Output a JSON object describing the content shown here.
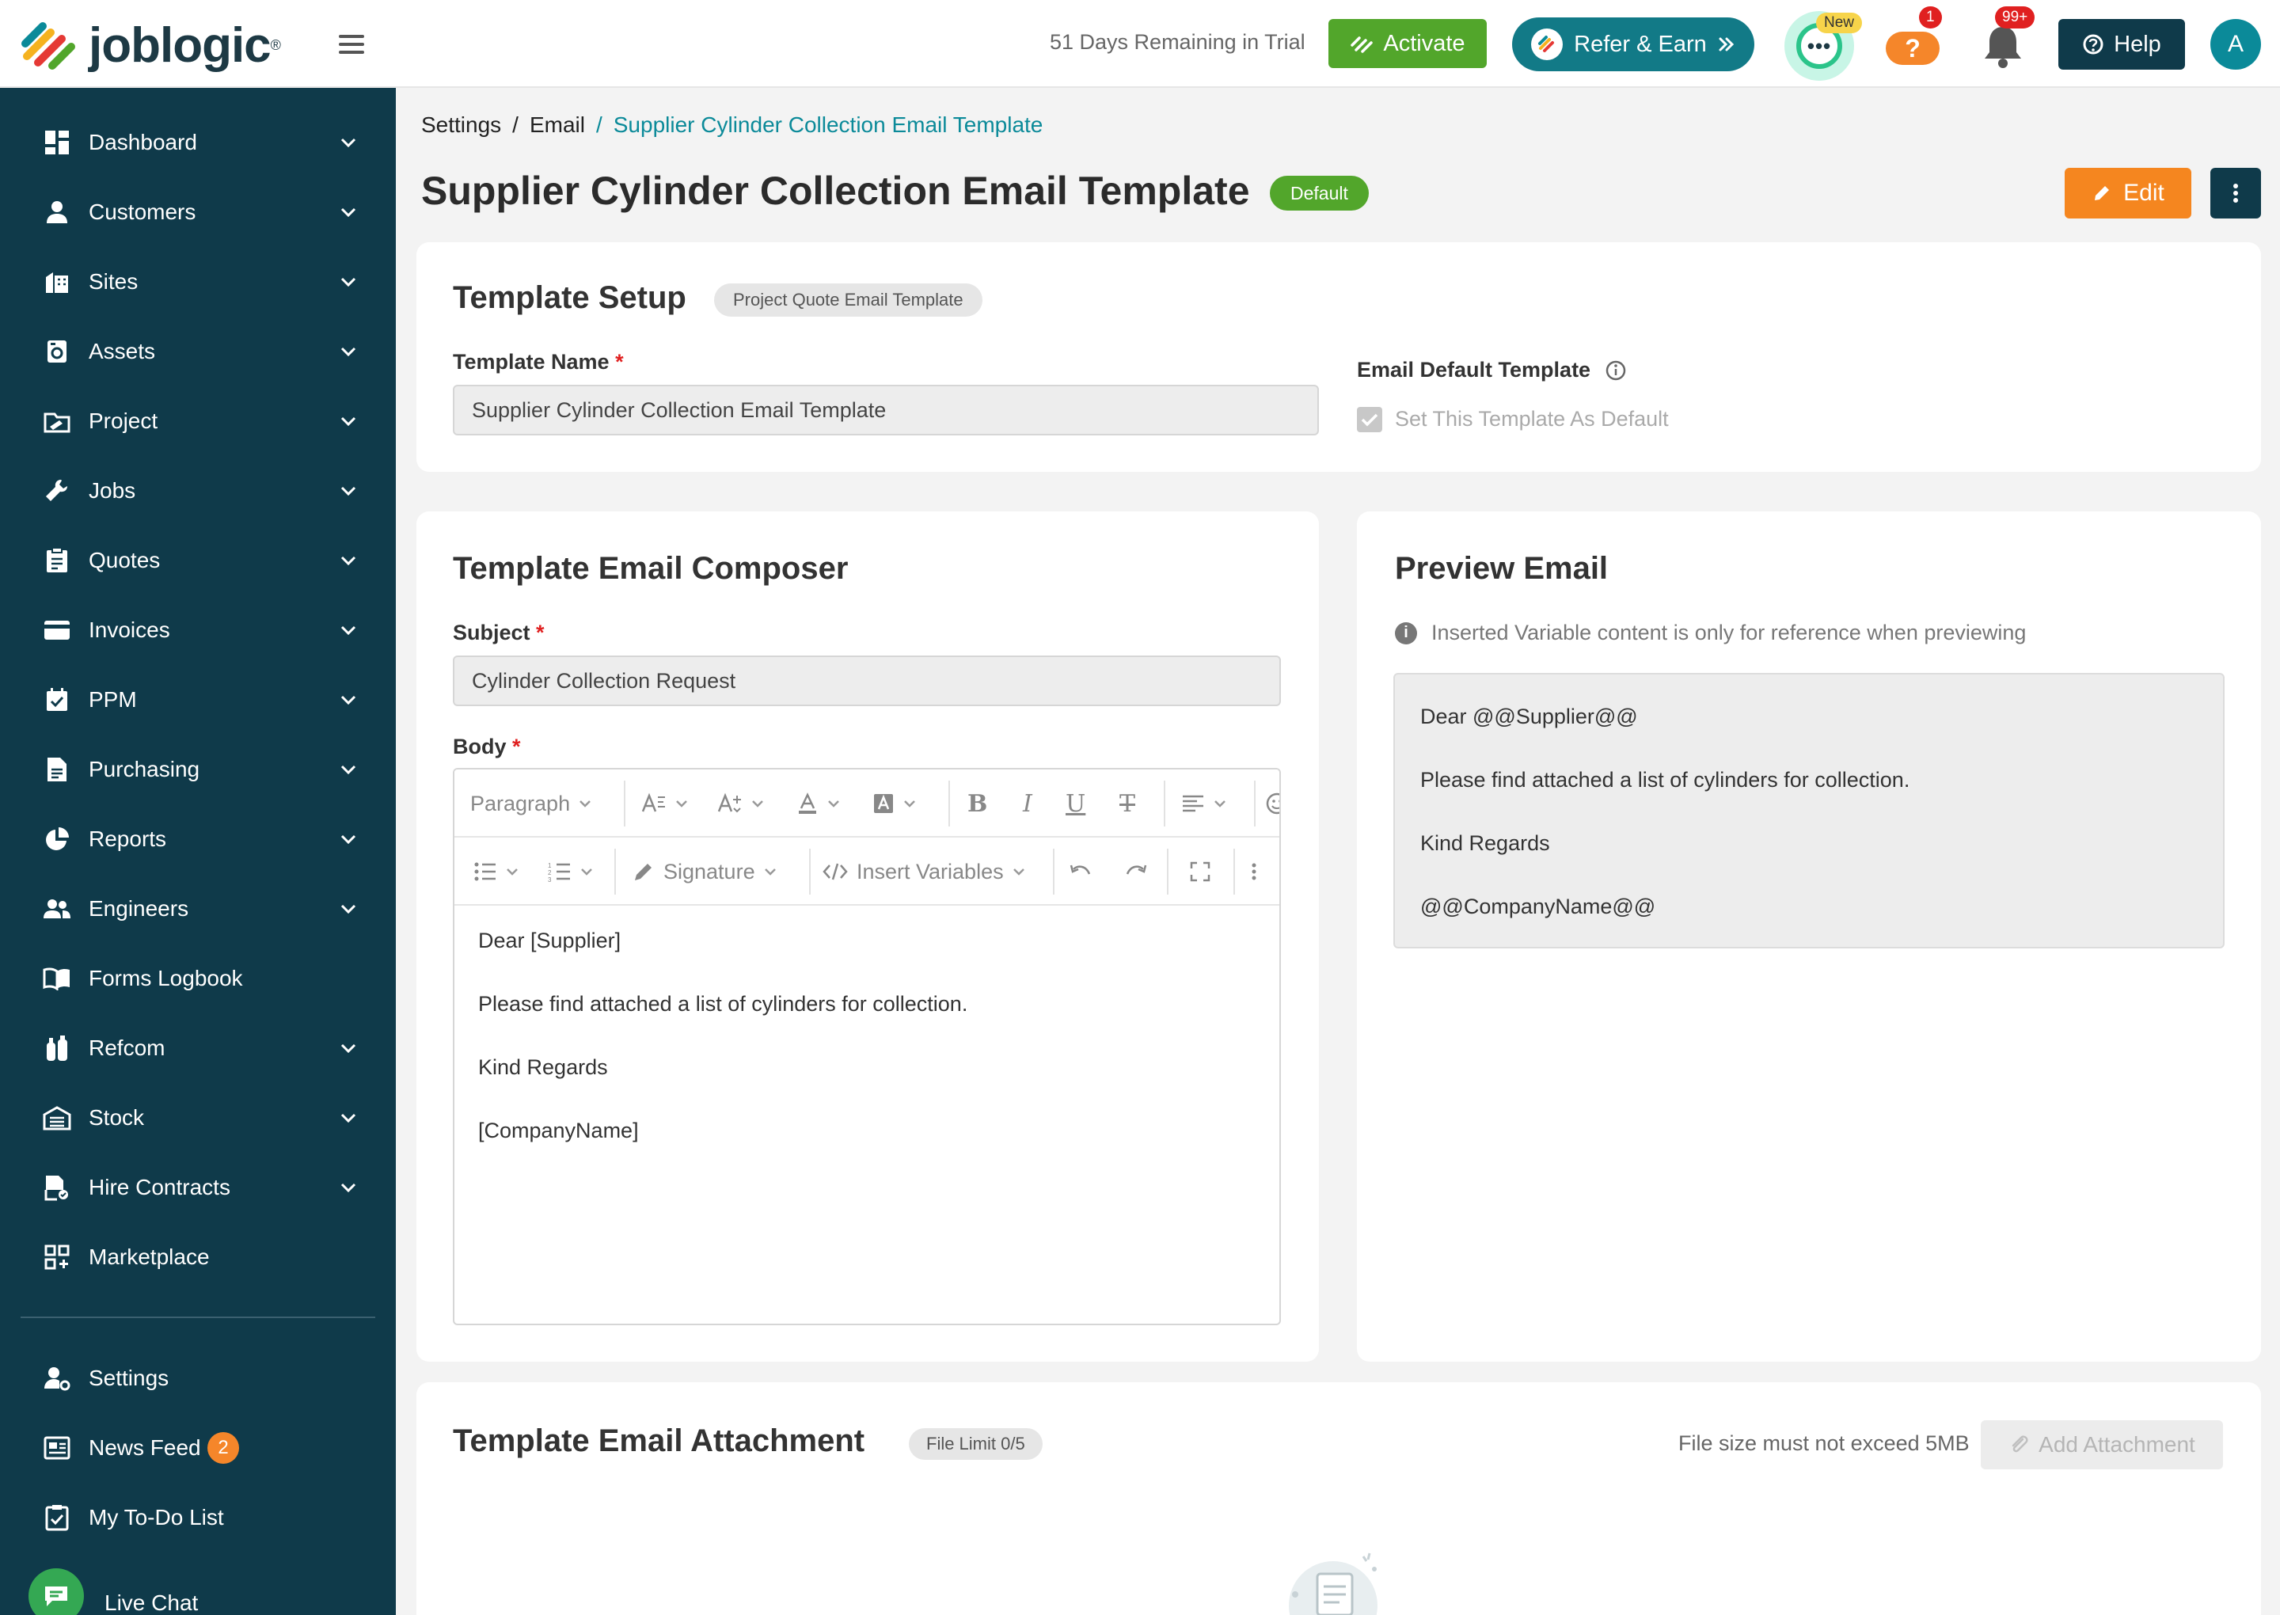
{
  "app": {
    "logo_text": "joblogic",
    "logo_reg": "®"
  },
  "header": {
    "trial_text": "51 Days Remaining in Trial",
    "activate_label": "Activate",
    "refer_label": "Refer & Earn",
    "chat_new_badge": "New",
    "help_badge": "1",
    "notifications_badge": "99+",
    "help_label": "Help",
    "avatar_initial": "A"
  },
  "sidebar": {
    "items": [
      {
        "label": "Dashboard",
        "icon": "dashboard-icon"
      },
      {
        "label": "Customers",
        "icon": "person-icon"
      },
      {
        "label": "Sites",
        "icon": "building-icon"
      },
      {
        "label": "Assets",
        "icon": "assets-icon"
      },
      {
        "label": "Project",
        "icon": "project-icon"
      },
      {
        "label": "Jobs",
        "icon": "wrench-icon"
      },
      {
        "label": "Quotes",
        "icon": "clipboard-icon"
      },
      {
        "label": "Invoices",
        "icon": "card-icon"
      },
      {
        "label": "PPM",
        "icon": "calendar-check-icon"
      },
      {
        "label": "Purchasing",
        "icon": "document-icon"
      },
      {
        "label": "Reports",
        "icon": "pie-chart-icon"
      },
      {
        "label": "Engineers",
        "icon": "people-icon"
      },
      {
        "label": "Forms Logbook",
        "icon": "book-icon"
      },
      {
        "label": "Refcom",
        "icon": "cylinder-icon"
      },
      {
        "label": "Stock",
        "icon": "warehouse-icon"
      },
      {
        "label": "Hire Contracts",
        "icon": "contract-icon"
      },
      {
        "label": "Marketplace",
        "icon": "grid-plus-icon"
      }
    ],
    "settings_label": "Settings",
    "news_feed_label": "News Feed",
    "news_feed_count": "2",
    "todo_label": "My To-Do List",
    "live_chat_label": "Live Chat"
  },
  "breadcrumb": {
    "settings": "Settings",
    "email": "Email",
    "current": "Supplier Cylinder Collection Email Template",
    "separator": "/"
  },
  "page": {
    "title": "Supplier Cylinder Collection Email Template",
    "default_badge": "Default",
    "edit_label": "Edit"
  },
  "setup": {
    "title": "Template Setup",
    "type_pill": "Project Quote Email Template",
    "name_label": "Template Name",
    "name_value": "Supplier Cylinder Collection Email Template",
    "default_label": "Email Default Template",
    "default_checkbox_label": "Set  This Template As Default",
    "required_mark": "*"
  },
  "composer": {
    "title": "Template Email Composer",
    "subject_label": "Subject",
    "subject_value": "Cylinder Collection Request",
    "body_label": "Body",
    "toolbar": {
      "paragraph": "Paragraph",
      "signature": "Signature",
      "insert_variables": "Insert Variables"
    },
    "body_lines": [
      "Dear [Supplier]",
      "Please find attached a list of cylinders for collection.",
      "Kind Regards",
      "[CompanyName]"
    ]
  },
  "preview": {
    "title": "Preview Email",
    "info_text": "Inserted Variable content is only for reference when previewing",
    "lines": [
      "Dear @@Supplier@@",
      "Please find attached a list of cylinders for collection.",
      "Kind Regards",
      "@@CompanyName@@"
    ]
  },
  "attachment": {
    "title": "Template Email Attachment",
    "file_limit": "File Limit 0/5",
    "size_note": "File size must not exceed 5MB",
    "add_label": "Add Attachment"
  },
  "colors": {
    "sidebar_bg": "#0f3a4a",
    "accent_teal": "#0b8a99",
    "activate_green": "#52a62b",
    "edit_orange": "#f5861f"
  }
}
